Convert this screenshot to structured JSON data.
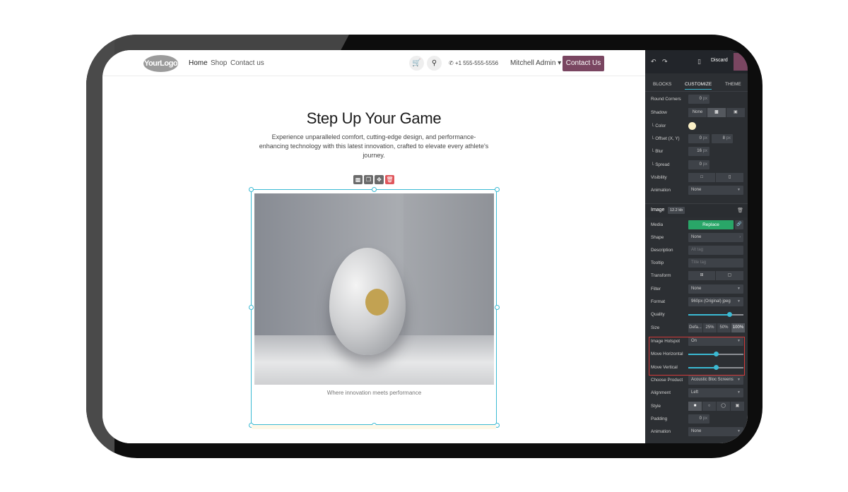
{
  "site": {
    "logo": "YourLogo",
    "nav": [
      "Home",
      "Shop",
      "Contact us"
    ],
    "phone": "+1 555-555-5556",
    "user": "Mitchell Admin",
    "cta": "Contact Us",
    "hero_title": "Step Up Your Game",
    "hero_sub": "Experience unparalleled comfort, cutting-edge design, and performance-enhancing technology with this latest innovation, crafted to elevate every athlete's journey.",
    "caption": "Where innovation meets performance"
  },
  "panel": {
    "discard": "Discard",
    "tabs": [
      "BLOCKS",
      "CUSTOMIZE",
      "THEME"
    ],
    "round_corners": {
      "label": "Round Corners",
      "value": "0",
      "unit": "px"
    },
    "shadow": {
      "label": "Shadow",
      "none": "None"
    },
    "color": {
      "label": "└ Color",
      "value": "#fbf0c6"
    },
    "offset": {
      "label": "└ Offset (X, Y)",
      "x": "0",
      "y": "8",
      "unit": "px"
    },
    "blur": {
      "label": "└ Blur",
      "value": "16",
      "unit": "px"
    },
    "spread": {
      "label": "└ Spread",
      "value": "0",
      "unit": "px"
    },
    "visibility": {
      "label": "Visibility"
    },
    "animation": {
      "label": "Animation",
      "value": "None"
    },
    "image_section": {
      "title": "Image",
      "size": "12.2 kb"
    },
    "media": {
      "label": "Media",
      "button": "Replace"
    },
    "shape": {
      "label": "Shape",
      "value": "None"
    },
    "description": {
      "label": "Description",
      "placeholder": "Alt tag"
    },
    "tooltip": {
      "label": "Tooltip",
      "placeholder": "Title tag"
    },
    "transform": {
      "label": "Transform"
    },
    "filter": {
      "label": "Filter",
      "value": "None"
    },
    "format": {
      "label": "Format",
      "value": "960px (Original) jpeg"
    },
    "quality": {
      "label": "Quality",
      "level": 0.75
    },
    "size": {
      "label": "Size",
      "options": [
        "Defa...",
        "25%",
        "50%",
        "100%"
      ]
    },
    "hotspot": {
      "label": "Image Hotspot",
      "value": "On"
    },
    "move_h": {
      "label": "Move Horizontal",
      "level": 0.5
    },
    "move_v": {
      "label": "Move Vertical",
      "level": 0.5
    },
    "product": {
      "label": "Choose Product",
      "value": "Acoustic Bloc Screens"
    },
    "alignment": {
      "label": "Alignment",
      "value": "Left"
    },
    "style": {
      "label": "Style"
    },
    "padding": {
      "label": "Padding",
      "value": "0",
      "unit": "px"
    },
    "animation2": {
      "label": "Animation",
      "value": "None"
    }
  },
  "colors": {
    "accent": "#3bbad3",
    "brand": "#7a4661",
    "replace": "#29a668",
    "highlight": "#d43a3a"
  }
}
